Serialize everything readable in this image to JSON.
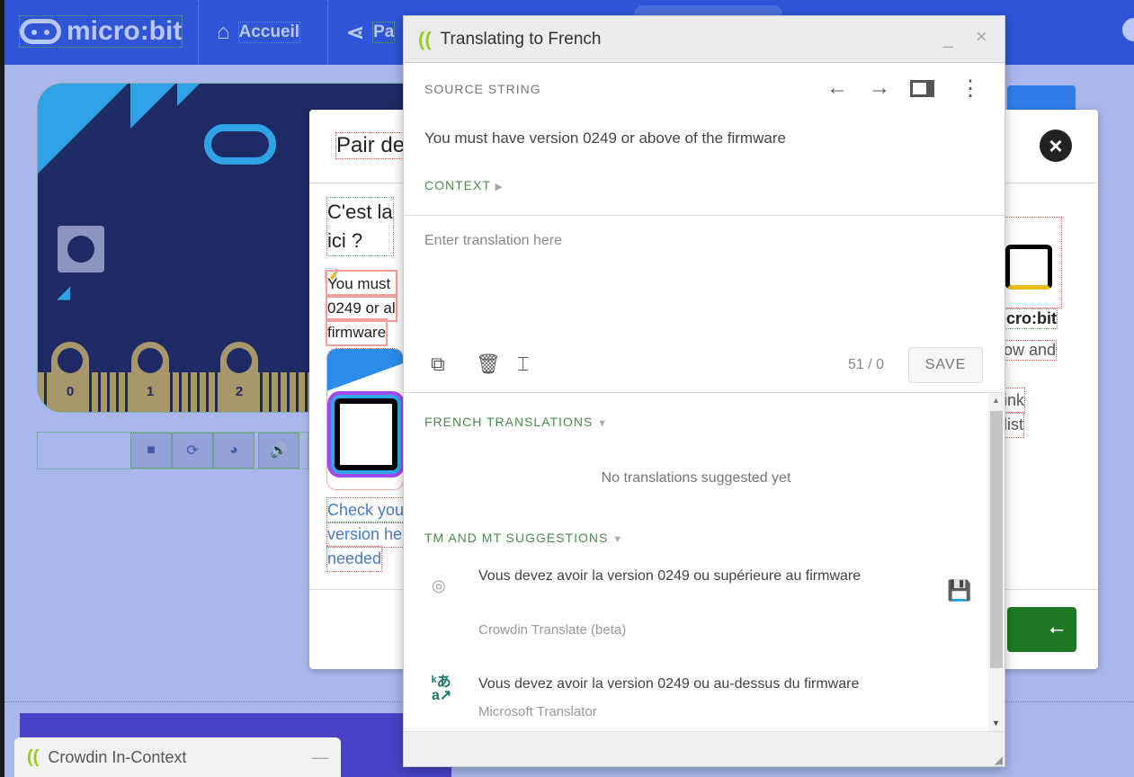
{
  "header": {
    "logo_text": "micro:bit",
    "nav": [
      {
        "label": "Accueil",
        "icon": "home-icon"
      },
      {
        "label": "Pa",
        "icon": "share-icon"
      }
    ]
  },
  "board": {
    "pins": [
      "0",
      "1",
      "2"
    ]
  },
  "controls": {
    "icons": [
      "stop-icon",
      "restart-icon",
      "slow-motion-icon",
      "sound-icon"
    ]
  },
  "crowdin_mini": {
    "title": "Crowdin In-Context"
  },
  "pair_dialog": {
    "title": "Pair de",
    "question": [
      "C'est la",
      "ici ?"
    ],
    "must_lines": [
      "You must",
      "0249 or al",
      "firmware"
    ],
    "link_lines": [
      "Check you",
      "version he",
      "needed"
    ],
    "right_lines": {
      "name": "icro:bit",
      "line1": "ow and",
      "line2": "ink",
      "line3": "list"
    }
  },
  "translate_window": {
    "title": "Translating to French",
    "source_label": "SOURCE STRING",
    "source_text": "You must have version 0249 or above of the firmware",
    "context_label": "CONTEXT",
    "input_placeholder": "Enter translation here",
    "counter": "51 / 0",
    "save_label": "SAVE",
    "french_translations_label": "FRENCH TRANSLATIONS",
    "no_translations": "No translations suggested yet",
    "tm_mt_label": "TM AND MT SUGGESTIONS",
    "suggestions": [
      {
        "text": "Vous devez avoir la version 0249 ou supérieure au firmware",
        "source": "Crowdin Translate (beta)"
      },
      {
        "text": "Vous devez avoir la version 0249 ou au-dessus du firmware",
        "source": "Microsoft Translator"
      }
    ]
  },
  "colors": {
    "header": "#2f54d6",
    "board": "#1e2a63",
    "accent_green": "#4e8a4e",
    "usb_button": "#1d7a22"
  }
}
